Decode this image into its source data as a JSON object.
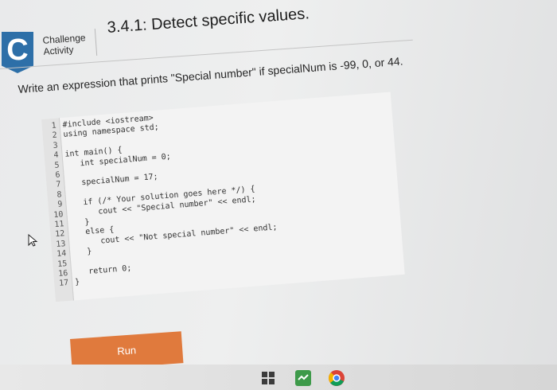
{
  "header": {
    "badge_letter": "C",
    "badge_line1": "Challenge",
    "badge_line2": "Activity",
    "title": "3.4.1: Detect specific values."
  },
  "prompt": "Write an expression that prints \"Special number\" if specialNum is -99, 0, or 44.",
  "editor": {
    "line_numbers": [
      "1",
      "2",
      "3",
      "4",
      "5",
      "6",
      "7",
      "8",
      "9",
      "10",
      "11",
      "12",
      "13",
      "14",
      "15",
      "16",
      "17"
    ],
    "lines": [
      "#include <iostream>",
      "using namespace std;",
      "",
      "int main() {",
      "   int specialNum = 0;",
      "",
      "   specialNum = 17;",
      "",
      "   if (/* Your solution goes here */) {",
      "      cout << \"Special number\" << endl;",
      "   }",
      "   else {",
      "      cout << \"Not special number\" << endl;",
      "   }",
      "",
      "   return 0;",
      "}"
    ]
  },
  "run_button": {
    "label": "Run"
  },
  "colors": {
    "badge": "#2d6fa8",
    "run_button": "#e07a3d"
  },
  "icons": [
    "cursor-icon",
    "start-icon",
    "app-icon",
    "chrome-icon"
  ]
}
